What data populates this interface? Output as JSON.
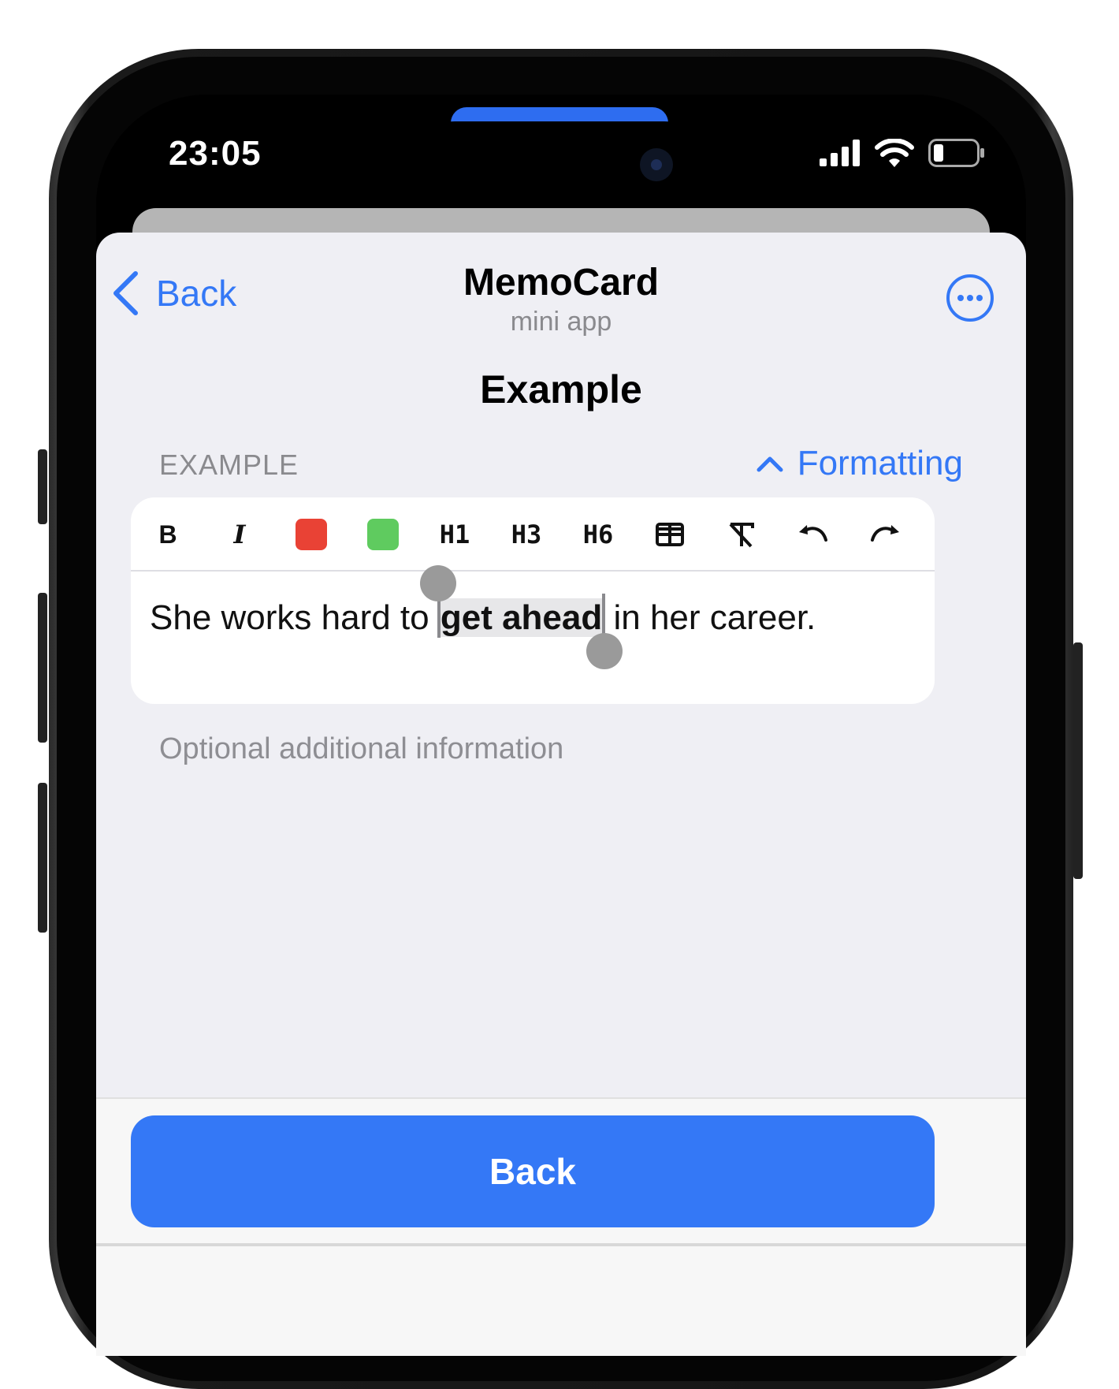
{
  "status_bar": {
    "time": "23:05",
    "icons": [
      "signal-icon",
      "wifi-icon",
      "battery-icon"
    ]
  },
  "nav": {
    "back_label": "Back",
    "title": "MemoCard",
    "subtitle": "mini app",
    "more_icon": "ellipsis-circle-icon"
  },
  "page": {
    "heading": "Example"
  },
  "section": {
    "label": "EXAMPLE",
    "formatting_label": "Formatting"
  },
  "toolbar": {
    "bold": "B",
    "italic": "I",
    "h1": "H1",
    "h3": "H3",
    "h6": "H6",
    "red_color": "#e94235",
    "green_color": "#5fcb5f"
  },
  "editor": {
    "text_before": "She works hard to ",
    "text_selected": "get ahead",
    "text_after": " in her career."
  },
  "extra": {
    "placeholder": "Optional additional information"
  },
  "footer": {
    "button_label": "Back"
  },
  "colors": {
    "accent": "#3478f6",
    "background": "#efeff4"
  }
}
